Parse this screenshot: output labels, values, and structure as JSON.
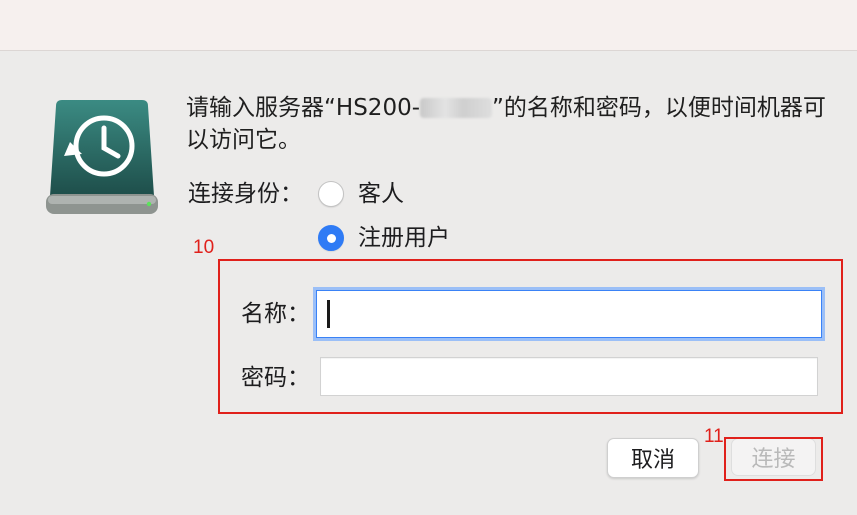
{
  "dialog": {
    "message_before": "请输入服务器“HS200-",
    "message_after": "”的名称和密码，以便时间机器可以访问它。"
  },
  "connect_as": {
    "label": "连接身份：",
    "options": [
      {
        "label": "客人",
        "checked": false
      },
      {
        "label": "注册用户",
        "checked": true
      }
    ]
  },
  "fields": {
    "name_label": "名称：",
    "name_value": "",
    "password_label": "密码：",
    "password_value": ""
  },
  "buttons": {
    "cancel": "取消",
    "connect": "连接"
  },
  "annotations": {
    "fields_number": "10",
    "connect_number": "11",
    "color": "#e0201b"
  },
  "colors": {
    "accent": "#2f7bf5",
    "drive_body": "#2e6b66"
  }
}
